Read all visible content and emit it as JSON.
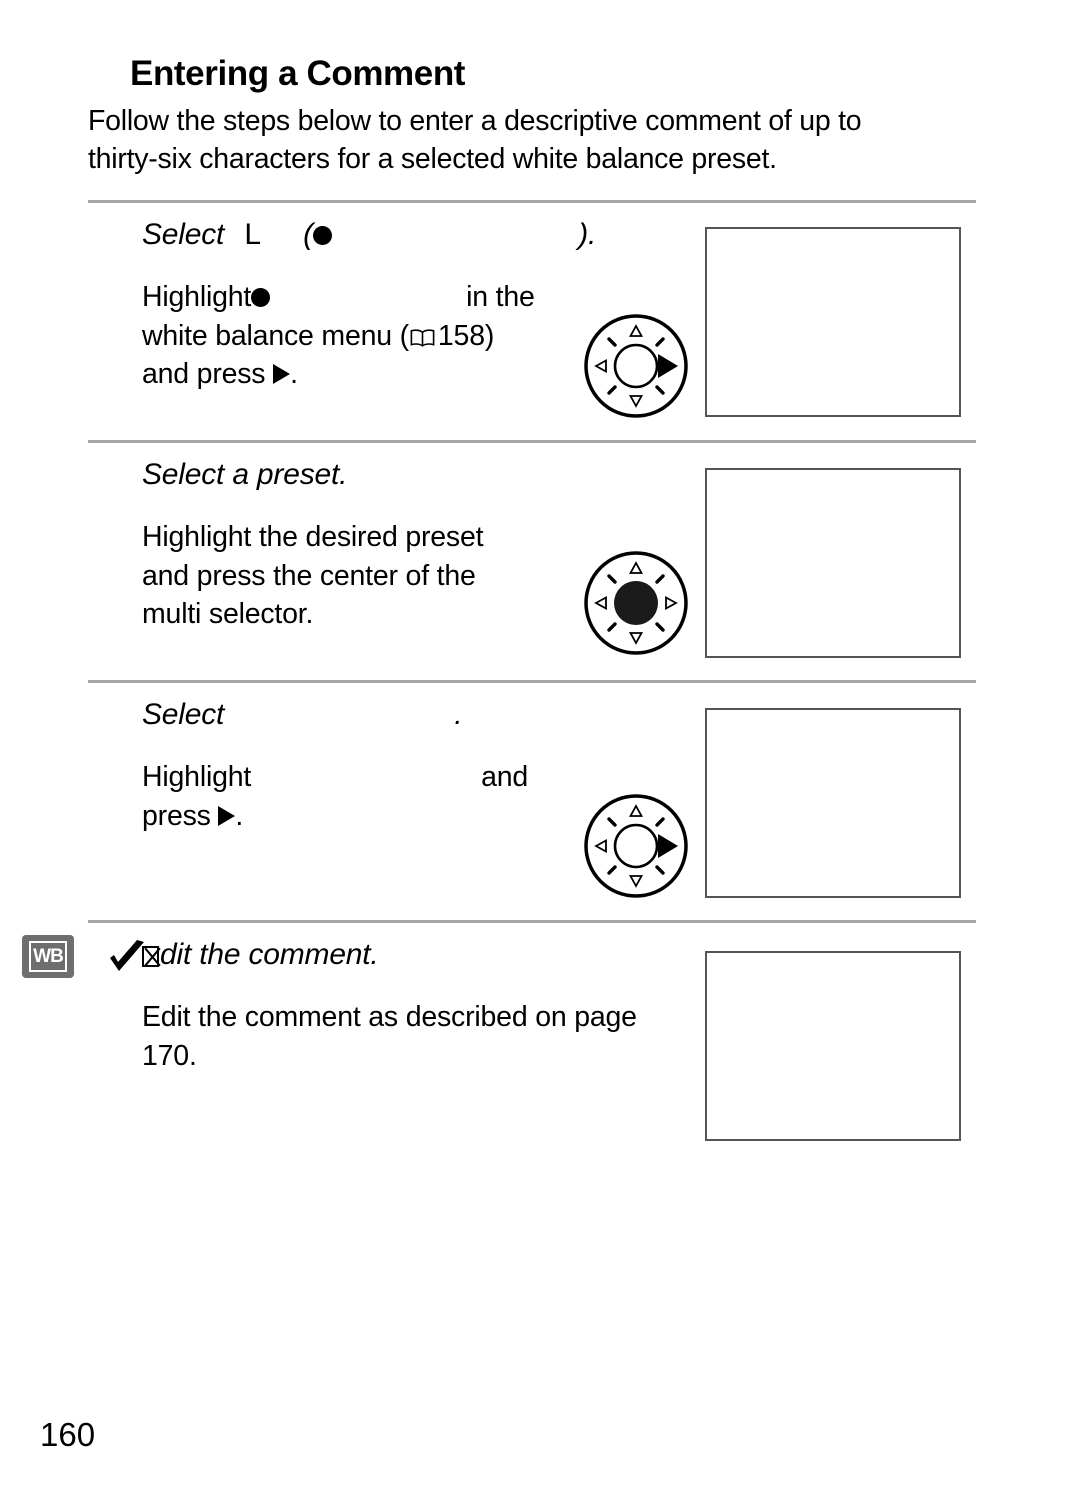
{
  "page": {
    "heading": "Entering a Comment",
    "intro_lines": [
      "Follow the steps below to enter a descriptive comment of up to",
      "thirty-six characters for a selected white balance preset."
    ],
    "page_number": "160",
    "side_tab_label": "WB",
    "rule_color": "#a6a6a6",
    "shot_border_color": "#555555",
    "tab_color": "#6e6e6e"
  },
  "steps": [
    {
      "index": "1",
      "title_prefix": "Select",
      "title_upright": "L",
      "title_paren_open": "(",
      "title_paren_close": ").",
      "body": {
        "line1_a": "Highlight",
        "line1_b": "in the",
        "line2_a": "white balance menu (",
        "line2_ref": "158",
        "line2_b": ")",
        "line3_a": "and press",
        "line3_b": "."
      },
      "dial": {
        "center": "hollow",
        "highlight": "right"
      }
    },
    {
      "index": "2",
      "title": "Select a preset.",
      "body": {
        "line1": "Highlight the desired preset",
        "line2": "and press the center of the",
        "line3": "multi selector."
      },
      "dial": {
        "center": "filled",
        "highlight": "center"
      }
    },
    {
      "index": "3",
      "title_prefix": "Select",
      "title_suffix": ".",
      "body": {
        "line1_a": "Highlight",
        "line1_b": "and",
        "line2_a": "press",
        "line2_b": "."
      },
      "dial": {
        "center": "hollow",
        "highlight": "right"
      }
    },
    {
      "index": "4",
      "title_missing_glyph": "☒",
      "title_rest": "dit the comment.",
      "body": {
        "line1": "Edit the comment as described on page",
        "line2": "170."
      },
      "has_checkmark": true,
      "has_side_tab": true
    }
  ],
  "icons": {
    "bullet": "filled-circle-icon",
    "arrow_right": "triangle-right-icon",
    "book": "book-reference-icon",
    "check": "checkmark-icon",
    "dial": "multi-selector-dial-icon"
  }
}
